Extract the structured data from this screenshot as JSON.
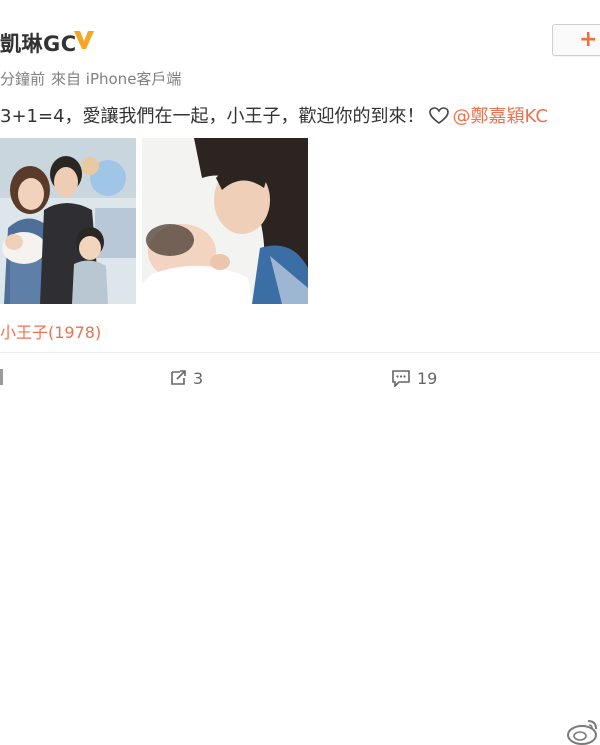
{
  "post": {
    "author": "凱琳GC",
    "badge_icon": "vip-v-icon",
    "follow_label": "+",
    "meta": {
      "time": "分鐘前",
      "via": "來自 iPhone客戶端"
    },
    "text": "3+1=4，愛讓我們在一起，小王子，歡迎你的到來！",
    "heart_icon": "heart-outline-icon",
    "mention": "@鄭嘉穎KC",
    "topic_link": "小王子(1978)",
    "images": [
      {
        "alt": "family-photo"
      },
      {
        "alt": "mother-with-baby-photo"
      }
    ]
  },
  "actions": {
    "repost": {
      "icon": "repost-icon",
      "count": "3"
    },
    "comment": {
      "icon": "comment-icon",
      "count": "19"
    }
  },
  "colors": {
    "accent": "#eb7350",
    "vip": "#f6a623",
    "text": "#333333",
    "meta": "#808080"
  }
}
